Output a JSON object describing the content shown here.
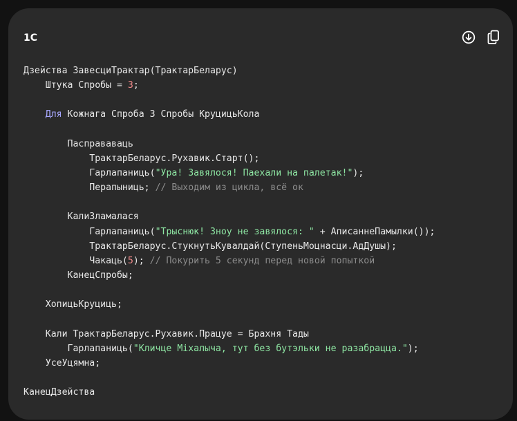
{
  "code_block": {
    "language": "1C",
    "download_icon": "download-icon",
    "copy_icon": "copy-icon",
    "lines": [
      [
        {
          "t": "Дзейства ЗавесциТрактар(ТрактарБеларус)",
          "c": ""
        }
      ],
      [
        {
          "t": "    Штука Спробы = ",
          "c": ""
        },
        {
          "t": "3",
          "c": "num"
        },
        {
          "t": ";",
          "c": ""
        }
      ],
      [],
      [
        {
          "t": "    ",
          "c": ""
        },
        {
          "t": "Для",
          "c": "kw"
        },
        {
          "t": " Кожнага Спроба 3 Спробы КруцицьКола",
          "c": ""
        }
      ],
      [],
      [
        {
          "t": "        Пасправаваць",
          "c": ""
        }
      ],
      [
        {
          "t": "            ТрактарБеларус.Рухавик.Старт();",
          "c": ""
        }
      ],
      [
        {
          "t": "            Гарлапаниць(",
          "c": ""
        },
        {
          "t": "\"Ура! Завялося! Паехали на палетак!\"",
          "c": "str"
        },
        {
          "t": ");",
          "c": ""
        }
      ],
      [
        {
          "t": "            Перапыниць; ",
          "c": ""
        },
        {
          "t": "// Выходим из цикла, всё ок",
          "c": "cmt"
        }
      ],
      [],
      [
        {
          "t": "        КалиЗламалася",
          "c": ""
        }
      ],
      [
        {
          "t": "            Гарлапаниць(",
          "c": ""
        },
        {
          "t": "\"Трыснюк! Зноу не завялося: \"",
          "c": "str"
        },
        {
          "t": " + АписаннеПамылки());",
          "c": ""
        }
      ],
      [
        {
          "t": "            ТрактарБеларус.СтукнутьКувалдай(СтупеньМоцнасци.АдДушы);",
          "c": ""
        }
      ],
      [
        {
          "t": "            Чакаць(",
          "c": ""
        },
        {
          "t": "5",
          "c": "num"
        },
        {
          "t": "); ",
          "c": ""
        },
        {
          "t": "// Покурить 5 секунд перед новой попыткой",
          "c": "cmt"
        }
      ],
      [
        {
          "t": "        КанецСпробы;",
          "c": ""
        }
      ],
      [],
      [
        {
          "t": "    ХопицьКруциць;",
          "c": ""
        }
      ],
      [],
      [
        {
          "t": "    Кали ТрактарБеларус.Рухавик.Працуе = Брахня Тады",
          "c": ""
        }
      ],
      [
        {
          "t": "        Гарлапаниць(",
          "c": ""
        },
        {
          "t": "\"Кличце Міхалыча, тут без бутэльки не разабрацца.\"",
          "c": "str"
        },
        {
          "t": ");",
          "c": ""
        }
      ],
      [
        {
          "t": "    УсеУцямна;",
          "c": ""
        }
      ],
      [],
      [
        {
          "t": "КанецДзейства",
          "c": ""
        }
      ]
    ]
  }
}
